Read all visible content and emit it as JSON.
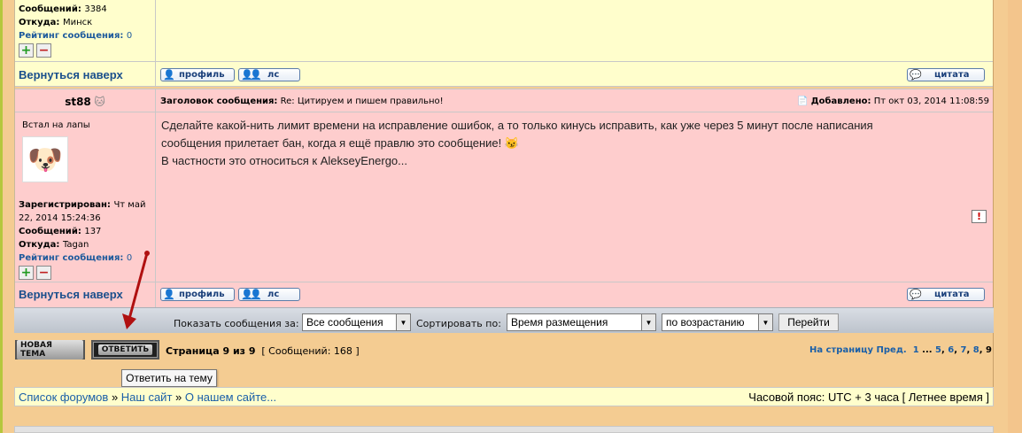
{
  "prev_post": {
    "messages_label": "Сообщений:",
    "messages_value": "3384",
    "from_label": "Откуда:",
    "from_value": "Минск",
    "rating_label": "Рейтинг сообщения:",
    "rating_value": "0"
  },
  "post_actions": {
    "back_to_top": "Вернуться наверх",
    "profile": "профиль",
    "pm": "лс",
    "quote": "цитата"
  },
  "post": {
    "author": "st88",
    "subject_label": "Заголовок сообщения:",
    "subject": "Re: Цитируем и пишем правильно!",
    "added_label": "Добавлено:",
    "added_value": "Пт окт 03, 2014 11:08:59",
    "rank": "Встал на лапы",
    "registered_label": "Зарегистрирован:",
    "registered_value": "Чт май 22, 2014 15:24:36",
    "messages_label": "Сообщений:",
    "messages_value": "137",
    "from_label": "Откуда:",
    "from_value": "Tagan",
    "rating_label": "Рейтинг сообщения:",
    "rating_value": "0",
    "text_line1": "Сделайте какой-нить лимит времени на исправление ошибок, а то только кинусь исправить, как уже через 5 минут после написания",
    "text_line2": "сообщения прилетает бан, когда я ещё правлю это сообщение!",
    "text_line3": "В частности это относиться к AlekseyEnergo..."
  },
  "toolbar": {
    "show_label": "Показать сообщения за:",
    "show_value": "Все сообщения",
    "sort_label": "Сортировать по:",
    "sort_value": "Время размещения",
    "order_value": "по возрастанию",
    "go": "Перейти"
  },
  "buttons": {
    "new_topic": "НОВАЯ ТЕМА",
    "reply": "ОТВЕТИТЬ",
    "reply_tooltip": "Ответить на тему"
  },
  "pagination": {
    "page_info": "Страница 9 из 9",
    "count_info": "[ Сообщений: 168 ]",
    "goto_label": "На страницу",
    "prev": "Пред.",
    "p1": "1",
    "ellipsis": "...",
    "p5": "5",
    "p6": "6",
    "p7": "7",
    "p8": "8",
    "p9": "9"
  },
  "breadcrumb": {
    "item1": "Список форумов",
    "sep": "»",
    "item2": "Наш сайт",
    "item3": "О нашем сайте...",
    "timezone": "Часовой пояс: UTC + 3 часа [ Летнее время ]"
  },
  "colors": {
    "page_bg": "#f4cc92",
    "post_bg_yellow": "#fffecc",
    "post_bg_pink": "#fecdcd",
    "link_blue": "#1a5fa8",
    "arrow_red": "#b01010"
  }
}
